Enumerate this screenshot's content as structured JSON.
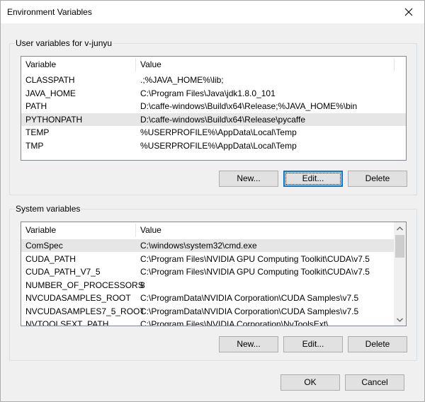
{
  "window": {
    "title": "Environment Variables"
  },
  "user_group": {
    "label": "User variables for v-junyu",
    "columns": [
      "Variable",
      "Value"
    ],
    "rows": [
      {
        "variable": "CLASSPATH",
        "value": ".;%JAVA_HOME%\\lib;"
      },
      {
        "variable": "JAVA_HOME",
        "value": "C:\\Program Files\\Java\\jdk1.8.0_101"
      },
      {
        "variable": "PATH",
        "value": "D:\\caffe-windows\\Build\\x64\\Release;%JAVA_HOME%\\bin"
      },
      {
        "variable": "PYTHONPATH",
        "value": "D:\\caffe-windows\\Build\\x64\\Release\\pycaffe",
        "selected": true
      },
      {
        "variable": "TEMP",
        "value": "%USERPROFILE%\\AppData\\Local\\Temp"
      },
      {
        "variable": "TMP",
        "value": "%USERPROFILE%\\AppData\\Local\\Temp"
      }
    ],
    "buttons": {
      "new": "New...",
      "edit": "Edit...",
      "delete": "Delete"
    }
  },
  "system_group": {
    "label": "System variables",
    "columns": [
      "Variable",
      "Value"
    ],
    "rows": [
      {
        "variable": "ComSpec",
        "value": "C:\\windows\\system32\\cmd.exe",
        "selected": true
      },
      {
        "variable": "CUDA_PATH",
        "value": "C:\\Program Files\\NVIDIA GPU Computing Toolkit\\CUDA\\v7.5"
      },
      {
        "variable": "CUDA_PATH_V7_5",
        "value": "C:\\Program Files\\NVIDIA GPU Computing Toolkit\\CUDA\\v7.5"
      },
      {
        "variable": "NUMBER_OF_PROCESSORS",
        "value": "8"
      },
      {
        "variable": "NVCUDASAMPLES_ROOT",
        "value": "C:\\ProgramData\\NVIDIA Corporation\\CUDA Samples\\v7.5"
      },
      {
        "variable": "NVCUDASAMPLES7_5_ROOT",
        "value": "C:\\ProgramData\\NVIDIA Corporation\\CUDA Samples\\v7.5"
      },
      {
        "variable": "NVTOOLSEXT_PATH",
        "value": "C:\\Program Files\\NVIDIA Corporation\\NvToolsExt\\"
      }
    ],
    "buttons": {
      "new": "New...",
      "edit": "Edit...",
      "delete": "Delete"
    }
  },
  "footer": {
    "ok": "OK",
    "cancel": "Cancel"
  },
  "colors": {
    "focus": "#0078d7",
    "selected_row": "#e6e6e6",
    "button_face": "#e1e1e1"
  }
}
